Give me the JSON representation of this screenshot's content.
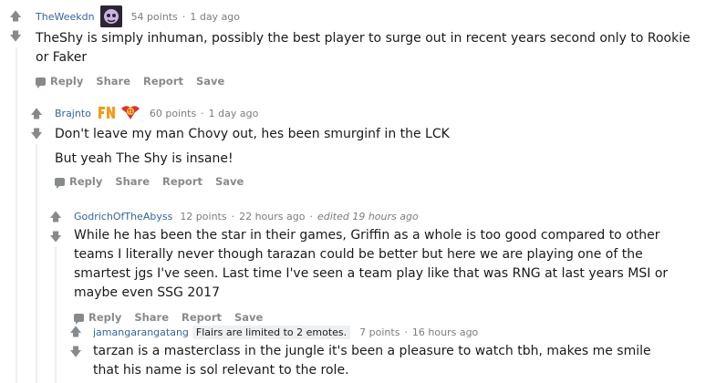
{
  "comments": [
    {
      "username": "TheWeekdn",
      "points": "54 points",
      "time": "1 day ago",
      "body": [
        "TheShy is simply inhuman, possibly the best player to surge out in recent years second only to Rookie or Faker"
      ],
      "actions": {
        "reply": "Reply",
        "share": "Share",
        "report": "Report",
        "save": "Save"
      }
    },
    {
      "username": "Brajnto",
      "points": "60 points",
      "time": "1 day ago",
      "body": [
        "Don't leave my man Chovy out, hes been smurginf in the LCK",
        "But yeah The Shy is insane!"
      ],
      "actions": {
        "reply": "Reply",
        "share": "Share",
        "report": "Report",
        "save": "Save"
      }
    },
    {
      "username": "GodrichOfTheAbyss",
      "points": "12 points",
      "time": "22 hours ago",
      "edited": "edited 19 hours ago",
      "body": [
        "While he has been the star in their games, Griffin as a whole is too good compared to other teams I literally never though tarazan could be better but here we are playing one of the smartest jgs I've seen. Last time I've seen a team play like that was RNG at last years MSI or maybe even SSG 2017"
      ],
      "actions": {
        "reply": "Reply",
        "share": "Share",
        "report": "Report",
        "save": "Save"
      }
    },
    {
      "username": "jamangarangatang",
      "flair": "Flairs are limited to 2 emotes.",
      "points": "7 points",
      "time": "16 hours ago",
      "body": [
        "tarzan is a masterclass in the jungle it's been a pleasure to watch tbh, makes me smile that his name is sol relevant to the role."
      ]
    }
  ],
  "colors": {
    "username": "#336699",
    "meta": "#7c7c7c",
    "action": "#878a8c"
  }
}
